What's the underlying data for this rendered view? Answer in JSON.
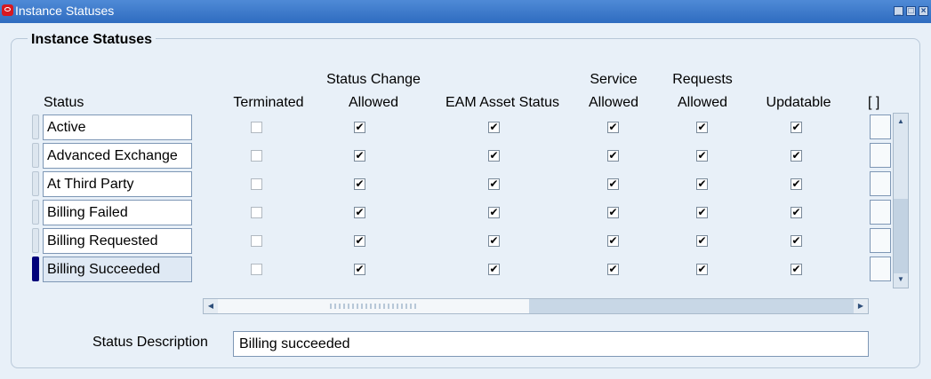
{
  "window": {
    "title": "Instance Statuses",
    "controls": [
      "minimize",
      "maximize",
      "close"
    ]
  },
  "panel": {
    "title": "Instance Statuses"
  },
  "columns": {
    "status": "Status",
    "terminated": "Terminated",
    "status_change_1": "Status Change",
    "status_change_2": "Allowed",
    "eam": "EAM Asset Status",
    "service_1": "Service",
    "service_2": "Allowed",
    "requests_1": "Requests",
    "requests_2": "Allowed",
    "updatable": "Updatable",
    "flex": "[ ]"
  },
  "rows": [
    {
      "status": "Active",
      "terminated": false,
      "status_change_allowed": true,
      "eam_asset_status": true,
      "service_allowed": true,
      "requests_allowed": true,
      "updatable": true,
      "selected": false
    },
    {
      "status": "Advanced Exchange",
      "terminated": false,
      "status_change_allowed": true,
      "eam_asset_status": true,
      "service_allowed": true,
      "requests_allowed": true,
      "updatable": true,
      "selected": false
    },
    {
      "status": "At Third Party",
      "terminated": false,
      "status_change_allowed": true,
      "eam_asset_status": true,
      "service_allowed": true,
      "requests_allowed": true,
      "updatable": true,
      "selected": false
    },
    {
      "status": "Billing Failed",
      "terminated": false,
      "status_change_allowed": true,
      "eam_asset_status": true,
      "service_allowed": true,
      "requests_allowed": true,
      "updatable": true,
      "selected": false
    },
    {
      "status": "Billing Requested",
      "terminated": false,
      "status_change_allowed": true,
      "eam_asset_status": true,
      "service_allowed": true,
      "requests_allowed": true,
      "updatable": true,
      "selected": false
    },
    {
      "status": "Billing Succeeded",
      "terminated": false,
      "status_change_allowed": true,
      "eam_asset_status": true,
      "service_allowed": true,
      "requests_allowed": true,
      "updatable": true,
      "selected": true
    }
  ],
  "description": {
    "label": "Status Description",
    "value": "Billing succeeded"
  },
  "colors": {
    "titlebar": "#2f6cc0",
    "background": "#e8f0f8",
    "record_indicator_active": "#00007a"
  }
}
